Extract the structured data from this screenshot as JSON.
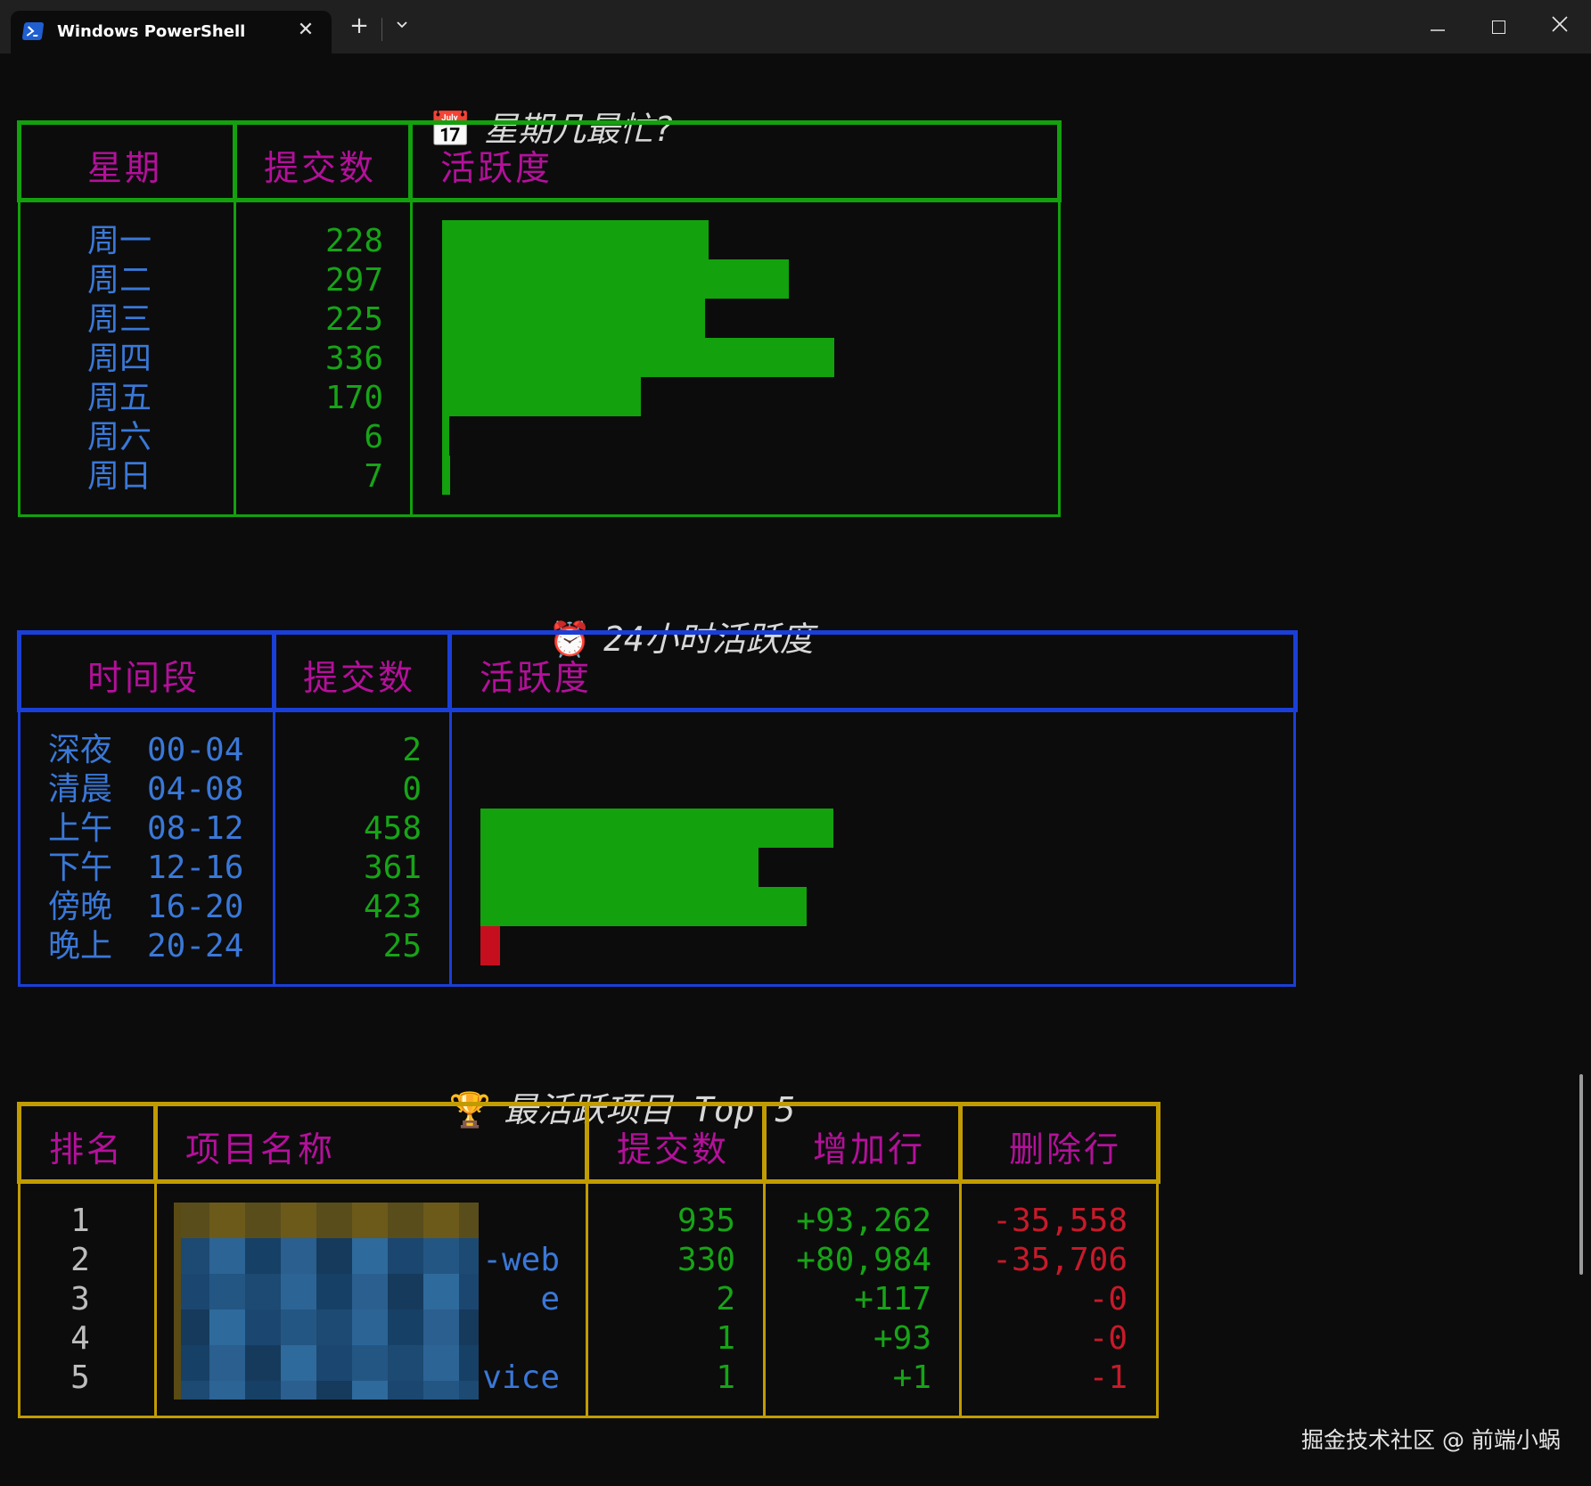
{
  "window": {
    "tab_title": "Windows PowerShell",
    "tab_close": "✕",
    "new_tab": "+",
    "dropdown": "⌄",
    "minimize": "—",
    "close": "✕",
    "icons": [
      "powershell-icon"
    ]
  },
  "weekday": {
    "emoji": "📅",
    "title": "星期几最忙?",
    "headers": [
      "星期",
      "提交数",
      "活跃度"
    ],
    "rows": [
      {
        "label": "周一",
        "count": "228"
      },
      {
        "label": "周二",
        "count": "297"
      },
      {
        "label": "周三",
        "count": "225"
      },
      {
        "label": "周四",
        "count": "336"
      },
      {
        "label": "周五",
        "count": "170"
      },
      {
        "label": "周六",
        "count": "6"
      },
      {
        "label": "周日",
        "count": "7"
      }
    ],
    "border_color": "#13a10e"
  },
  "hourly": {
    "emoji": "⏰",
    "title": "24小时活跃度",
    "headers": [
      "时间段",
      "提交数",
      "活跃度"
    ],
    "rows": [
      {
        "label": "深夜",
        "range": "00-04",
        "count": "2"
      },
      {
        "label": "清晨",
        "range": "04-08",
        "count": "0"
      },
      {
        "label": "上午",
        "range": "08-12",
        "count": "458"
      },
      {
        "label": "下午",
        "range": "12-16",
        "count": "361"
      },
      {
        "label": "傍晚",
        "range": "16-20",
        "count": "423"
      },
      {
        "label": "晚上",
        "range": "20-24",
        "count": "25"
      }
    ],
    "border_color": "#1a3fd8"
  },
  "projects": {
    "emoji": "🏆",
    "title": "最活跃项目 Top 5",
    "headers": [
      "排名",
      "项目名称",
      "提交数",
      "增加行",
      "删除行"
    ],
    "rows": [
      {
        "rank": "1",
        "name": "",
        "commits": "935",
        "added": "+93,262",
        "deleted": "-35,558"
      },
      {
        "rank": "2",
        "name": "-web",
        "commits": "330",
        "added": "+80,984",
        "deleted": "-35,706"
      },
      {
        "rank": "3",
        "name": "e",
        "commits": "2",
        "added": "+117",
        "deleted": "-0"
      },
      {
        "rank": "4",
        "name": "",
        "commits": "1",
        "added": "+93",
        "deleted": "-0"
      },
      {
        "rank": "5",
        "name": "vice",
        "commits": "1",
        "added": "+1",
        "deleted": "-1"
      }
    ],
    "border_color": "#c19c00"
  },
  "chart_data": [
    {
      "type": "bar",
      "categories": [
        "周一",
        "周二",
        "周三",
        "周四",
        "周五",
        "周六",
        "周日"
      ],
      "values": [
        228,
        297,
        225,
        336,
        170,
        6,
        7
      ]
    },
    {
      "type": "bar",
      "categories": [
        "深夜 00-04",
        "清晨 04-08",
        "上午 08-12",
        "下午 12-16",
        "傍晚 16-20",
        "晚上 20-24"
      ],
      "values": [
        2,
        0,
        458,
        361,
        423,
        25
      ]
    }
  ],
  "watermark": "掘金技术社区 @ 前端小蜗"
}
